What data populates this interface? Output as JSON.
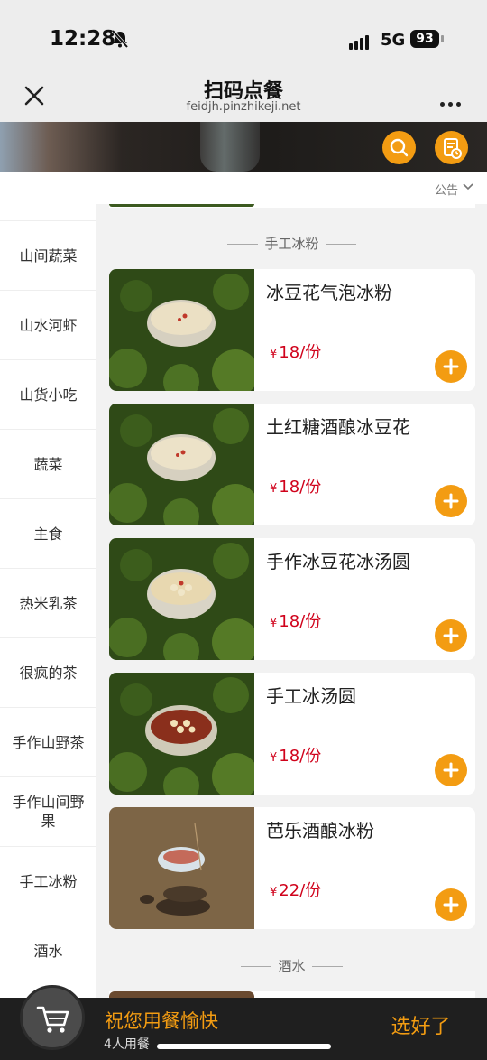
{
  "status_bar": {
    "time": "12:28",
    "network": "5G",
    "battery": "93"
  },
  "nav": {
    "title": "扫码点餐",
    "url": "feidjh.pinzhikeji.net"
  },
  "notice": {
    "label": "公告"
  },
  "sidebar": {
    "items": [
      {
        "label": "山间蔬菜"
      },
      {
        "label": "山水河虾"
      },
      {
        "label": "山货小吃"
      },
      {
        "label": "蔬菜"
      },
      {
        "label": "主食"
      },
      {
        "label": "热米乳茶"
      },
      {
        "label": "很疯的茶"
      },
      {
        "label": "手作山野茶"
      },
      {
        "label": "手作山间野果"
      },
      {
        "label": "手工冰粉"
      },
      {
        "label": "酒水"
      }
    ]
  },
  "menu": {
    "section_title": "手工冰粉",
    "next_section_title": "酒水",
    "currency": "¥",
    "items": [
      {
        "name": "冰豆花气泡冰粉",
        "price": "18/份"
      },
      {
        "name": "土红糖酒酿冰豆花",
        "price": "18/份"
      },
      {
        "name": "手作冰豆花冰汤圆",
        "price": "18/份"
      },
      {
        "name": "手工冰汤圆",
        "price": "18/份"
      },
      {
        "name": "芭乐酒酿冰粉",
        "price": "22/份"
      }
    ]
  },
  "bottom_bar": {
    "greeting": "祝您用餐愉快",
    "diners": "4人用餐",
    "checkout_label": "选好了"
  },
  "colors": {
    "accent": "#f39c12",
    "price": "#d0021b",
    "bottom_bar": "#1f1f1f"
  },
  "icons": [
    "bell-slash-icon",
    "close-icon",
    "more-icon",
    "search-icon",
    "order-list-icon",
    "chevron-down-icon",
    "plus-icon",
    "cart-icon"
  ]
}
